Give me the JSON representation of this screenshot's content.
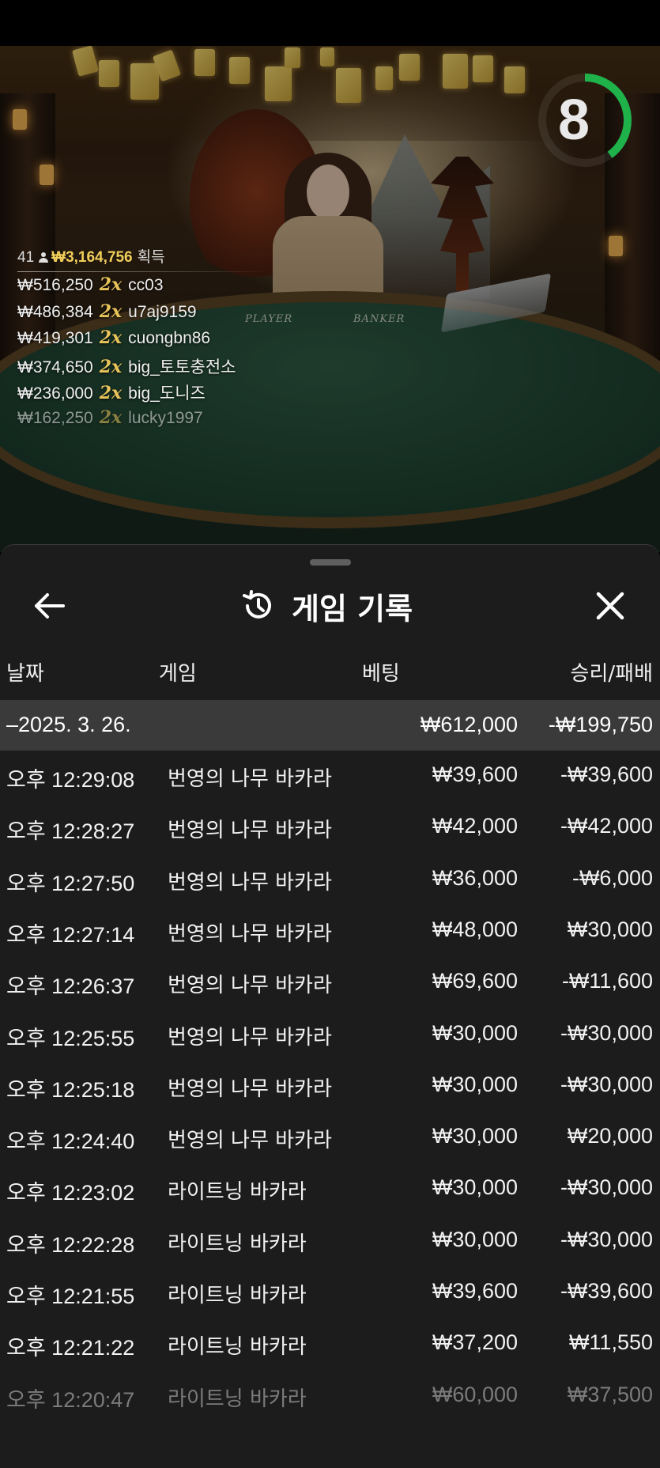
{
  "timer": {
    "value": "8",
    "progress": 0.4,
    "color": "#1fb24a"
  },
  "table": {
    "player_label": "PLAYER",
    "banker_label": "BANKER"
  },
  "winners": {
    "count": "41",
    "total": "₩3,164,756",
    "won_label": "획득",
    "list": [
      {
        "amount": "₩516,250",
        "multiplier": "2x",
        "name": "cc03"
      },
      {
        "amount": "₩486,384",
        "multiplier": "2x",
        "name": "u7aj9159"
      },
      {
        "amount": "₩419,301",
        "multiplier": "2x",
        "name": "cuongbn86"
      },
      {
        "amount": "₩374,650",
        "multiplier": "2x",
        "name": "big_토토충전소"
      },
      {
        "amount": "₩236,000",
        "multiplier": "2x",
        "name": "big_도니즈"
      },
      {
        "amount": "₩162,250",
        "multiplier": "2x",
        "name": "lucky1997"
      }
    ]
  },
  "sheet": {
    "title": "게임 기록",
    "icons": {
      "back": "arrow-left-icon",
      "history": "history-icon",
      "close": "close-icon"
    },
    "columns": {
      "date": "날짜",
      "game": "게임",
      "bet": "베팅",
      "result": "승리/패배"
    },
    "summary": {
      "date": "–2025. 3. 26.",
      "bet": "₩612,000",
      "result": "-₩199,750"
    },
    "rows": [
      {
        "time": "오후 12:29:08",
        "game": "번영의 나무 바카라",
        "bet": "₩39,600",
        "result": "-₩39,600"
      },
      {
        "time": "오후 12:28:27",
        "game": "번영의 나무 바카라",
        "bet": "₩42,000",
        "result": "-₩42,000"
      },
      {
        "time": "오후 12:27:50",
        "game": "번영의 나무 바카라",
        "bet": "₩36,000",
        "result": "-₩6,000"
      },
      {
        "time": "오후 12:27:14",
        "game": "번영의 나무 바카라",
        "bet": "₩48,000",
        "result": "₩30,000"
      },
      {
        "time": "오후 12:26:37",
        "game": "번영의 나무 바카라",
        "bet": "₩69,600",
        "result": "-₩11,600"
      },
      {
        "time": "오후 12:25:55",
        "game": "번영의 나무 바카라",
        "bet": "₩30,000",
        "result": "-₩30,000"
      },
      {
        "time": "오후 12:25:18",
        "game": "번영의 나무 바카라",
        "bet": "₩30,000",
        "result": "-₩30,000"
      },
      {
        "time": "오후 12:24:40",
        "game": "번영의 나무 바카라",
        "bet": "₩30,000",
        "result": "₩20,000"
      },
      {
        "time": "오후 12:23:02",
        "game": "라이트닝 바카라",
        "bet": "₩30,000",
        "result": "-₩30,000"
      },
      {
        "time": "오후 12:22:28",
        "game": "라이트닝 바카라",
        "bet": "₩30,000",
        "result": "-₩30,000"
      },
      {
        "time": "오후 12:21:55",
        "game": "라이트닝 바카라",
        "bet": "₩39,600",
        "result": "-₩39,600"
      },
      {
        "time": "오후 12:21:22",
        "game": "라이트닝 바카라",
        "bet": "₩37,200",
        "result": "₩11,550"
      },
      {
        "time": "오후 12:20:47",
        "game": "라이트닝 바카라",
        "bet": "₩60,000",
        "result": "₩37,500"
      }
    ]
  }
}
